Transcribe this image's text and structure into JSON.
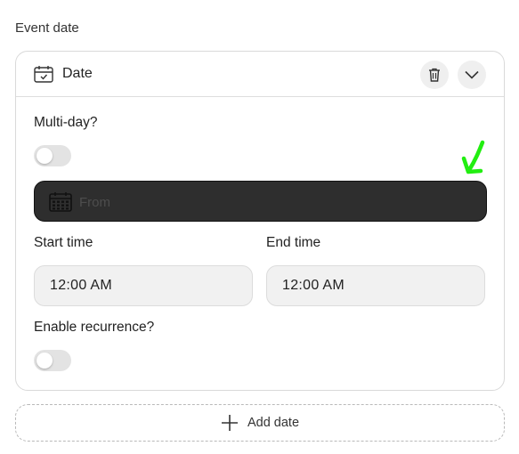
{
  "section": {
    "label": "Event date"
  },
  "card": {
    "title": "Date",
    "icons": {
      "calendar": "calendar-icon",
      "trash": "trash-icon",
      "chevron": "chevron-down-icon"
    },
    "multiday": {
      "label": "Multi-day?",
      "enabled": false
    },
    "date_field": {
      "placeholder": "From",
      "value": ""
    },
    "start_time": {
      "label": "Start time",
      "value": "12:00 AM"
    },
    "end_time": {
      "label": "End time",
      "value": "12:00 AM"
    },
    "recurrence": {
      "label": "Enable recurrence?",
      "enabled": false
    }
  },
  "add_date": {
    "label": "Add date"
  },
  "colors": {
    "annotation": "#22ee11",
    "date_field_bg": "#2e2e2e",
    "toggle_off": "#e3e3e3"
  }
}
